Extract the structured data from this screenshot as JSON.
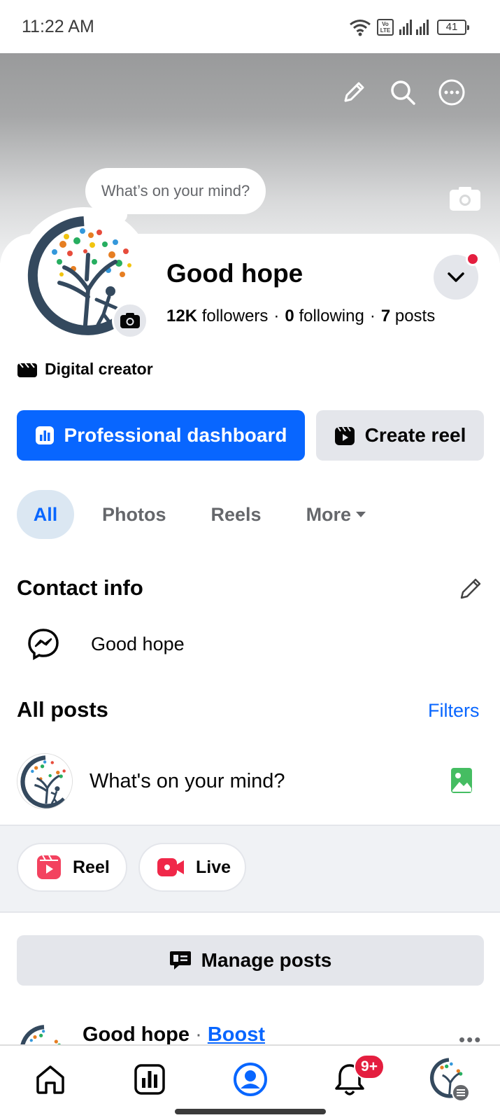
{
  "status_bar": {
    "time": "11:22 AM",
    "network_label": "Vo LTE",
    "battery": "41"
  },
  "cover": {
    "mind_prompt": "What’s on your mind?"
  },
  "profile": {
    "name": "Good hope",
    "followers_count": "12K",
    "followers_label": "followers",
    "following_count": "0",
    "following_label": "following",
    "posts_count": "7",
    "posts_label": "posts",
    "category": "Digital creator"
  },
  "actions": {
    "professional_dashboard": "Professional dashboard",
    "create_reel": "Create reel"
  },
  "tabs": [
    {
      "label": "All",
      "active": true
    },
    {
      "label": "Photos",
      "active": false
    },
    {
      "label": "Reels",
      "active": false
    },
    {
      "label": "More",
      "active": false
    }
  ],
  "contact_info": {
    "title": "Contact info",
    "messenger": "Good hope"
  },
  "all_posts": {
    "title": "All posts",
    "filters": "Filters",
    "composer_prompt": "What's on your mind?",
    "reel_label": "Reel",
    "live_label": "Live",
    "manage_posts": "Manage posts"
  },
  "post_preview": {
    "author": "Good hope",
    "separator": "·",
    "boost": "Boost",
    "more": "•••"
  },
  "bottom_nav": {
    "notifications_badge": "9+"
  },
  "colors": {
    "accent": "#0866ff",
    "badge": "#e41e3f",
    "button_gray": "#e4e6eb",
    "secondary_text": "#65676b"
  }
}
